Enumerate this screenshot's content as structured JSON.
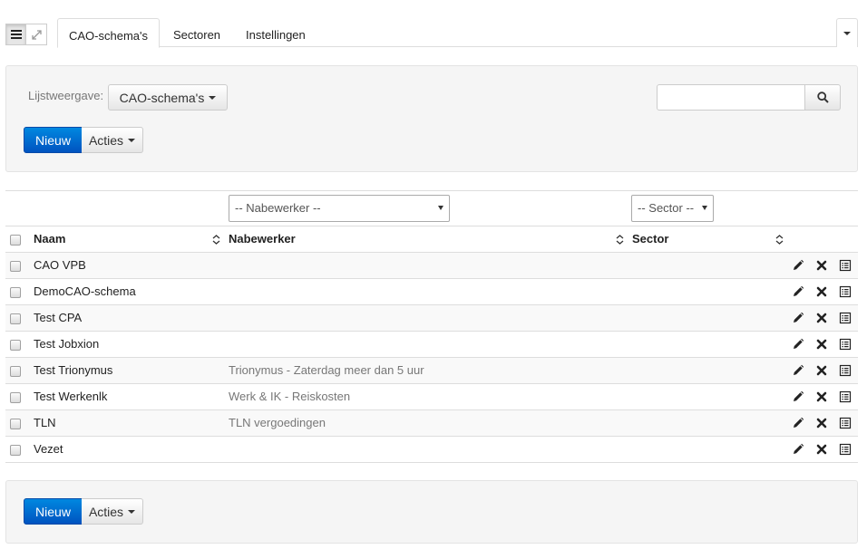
{
  "tabs": [
    {
      "label": "CAO-schema's",
      "active": true
    },
    {
      "label": "Sectoren",
      "active": false
    },
    {
      "label": "Instellingen",
      "active": false
    }
  ],
  "toolbar": {
    "list_view_label": "Lijstweergave:",
    "list_view_value": "CAO-schema's",
    "search_placeholder": "",
    "new_label": "Nieuw",
    "actions_label": "Acties"
  },
  "filters": {
    "nabewerker_placeholder": "-- Nabewerker --",
    "sector_placeholder": "-- Sector --"
  },
  "table": {
    "columns": [
      "Naam",
      "Nabewerker",
      "Sector"
    ],
    "rows": [
      {
        "naam": "CAO VPB",
        "nabewerker": "",
        "sector": ""
      },
      {
        "naam": "DemoCAO-schema",
        "nabewerker": "",
        "sector": ""
      },
      {
        "naam": "Test CPA",
        "nabewerker": "",
        "sector": ""
      },
      {
        "naam": "Test Jobxion",
        "nabewerker": "",
        "sector": ""
      },
      {
        "naam": "Test Trionymus",
        "nabewerker": "Trionymus - Zaterdag meer dan 5 uur",
        "sector": ""
      },
      {
        "naam": "Test Werkenlk",
        "nabewerker": "Werk & IK - Reiskosten",
        "sector": ""
      },
      {
        "naam": "TLN",
        "nabewerker": "TLN vergoedingen",
        "sector": ""
      },
      {
        "naam": "Vezet",
        "nabewerker": "",
        "sector": ""
      }
    ]
  },
  "bottom_toolbar": {
    "new_label": "Nieuw",
    "actions_label": "Acties"
  },
  "icons": {
    "list_view": "list-icon",
    "expand": "expand-icon",
    "search": "search-icon",
    "sort": "sort-icon",
    "edit": "pencil-icon",
    "delete": "close-icon",
    "details": "list-details-icon"
  },
  "colors": {
    "primary": "#0066cc"
  }
}
